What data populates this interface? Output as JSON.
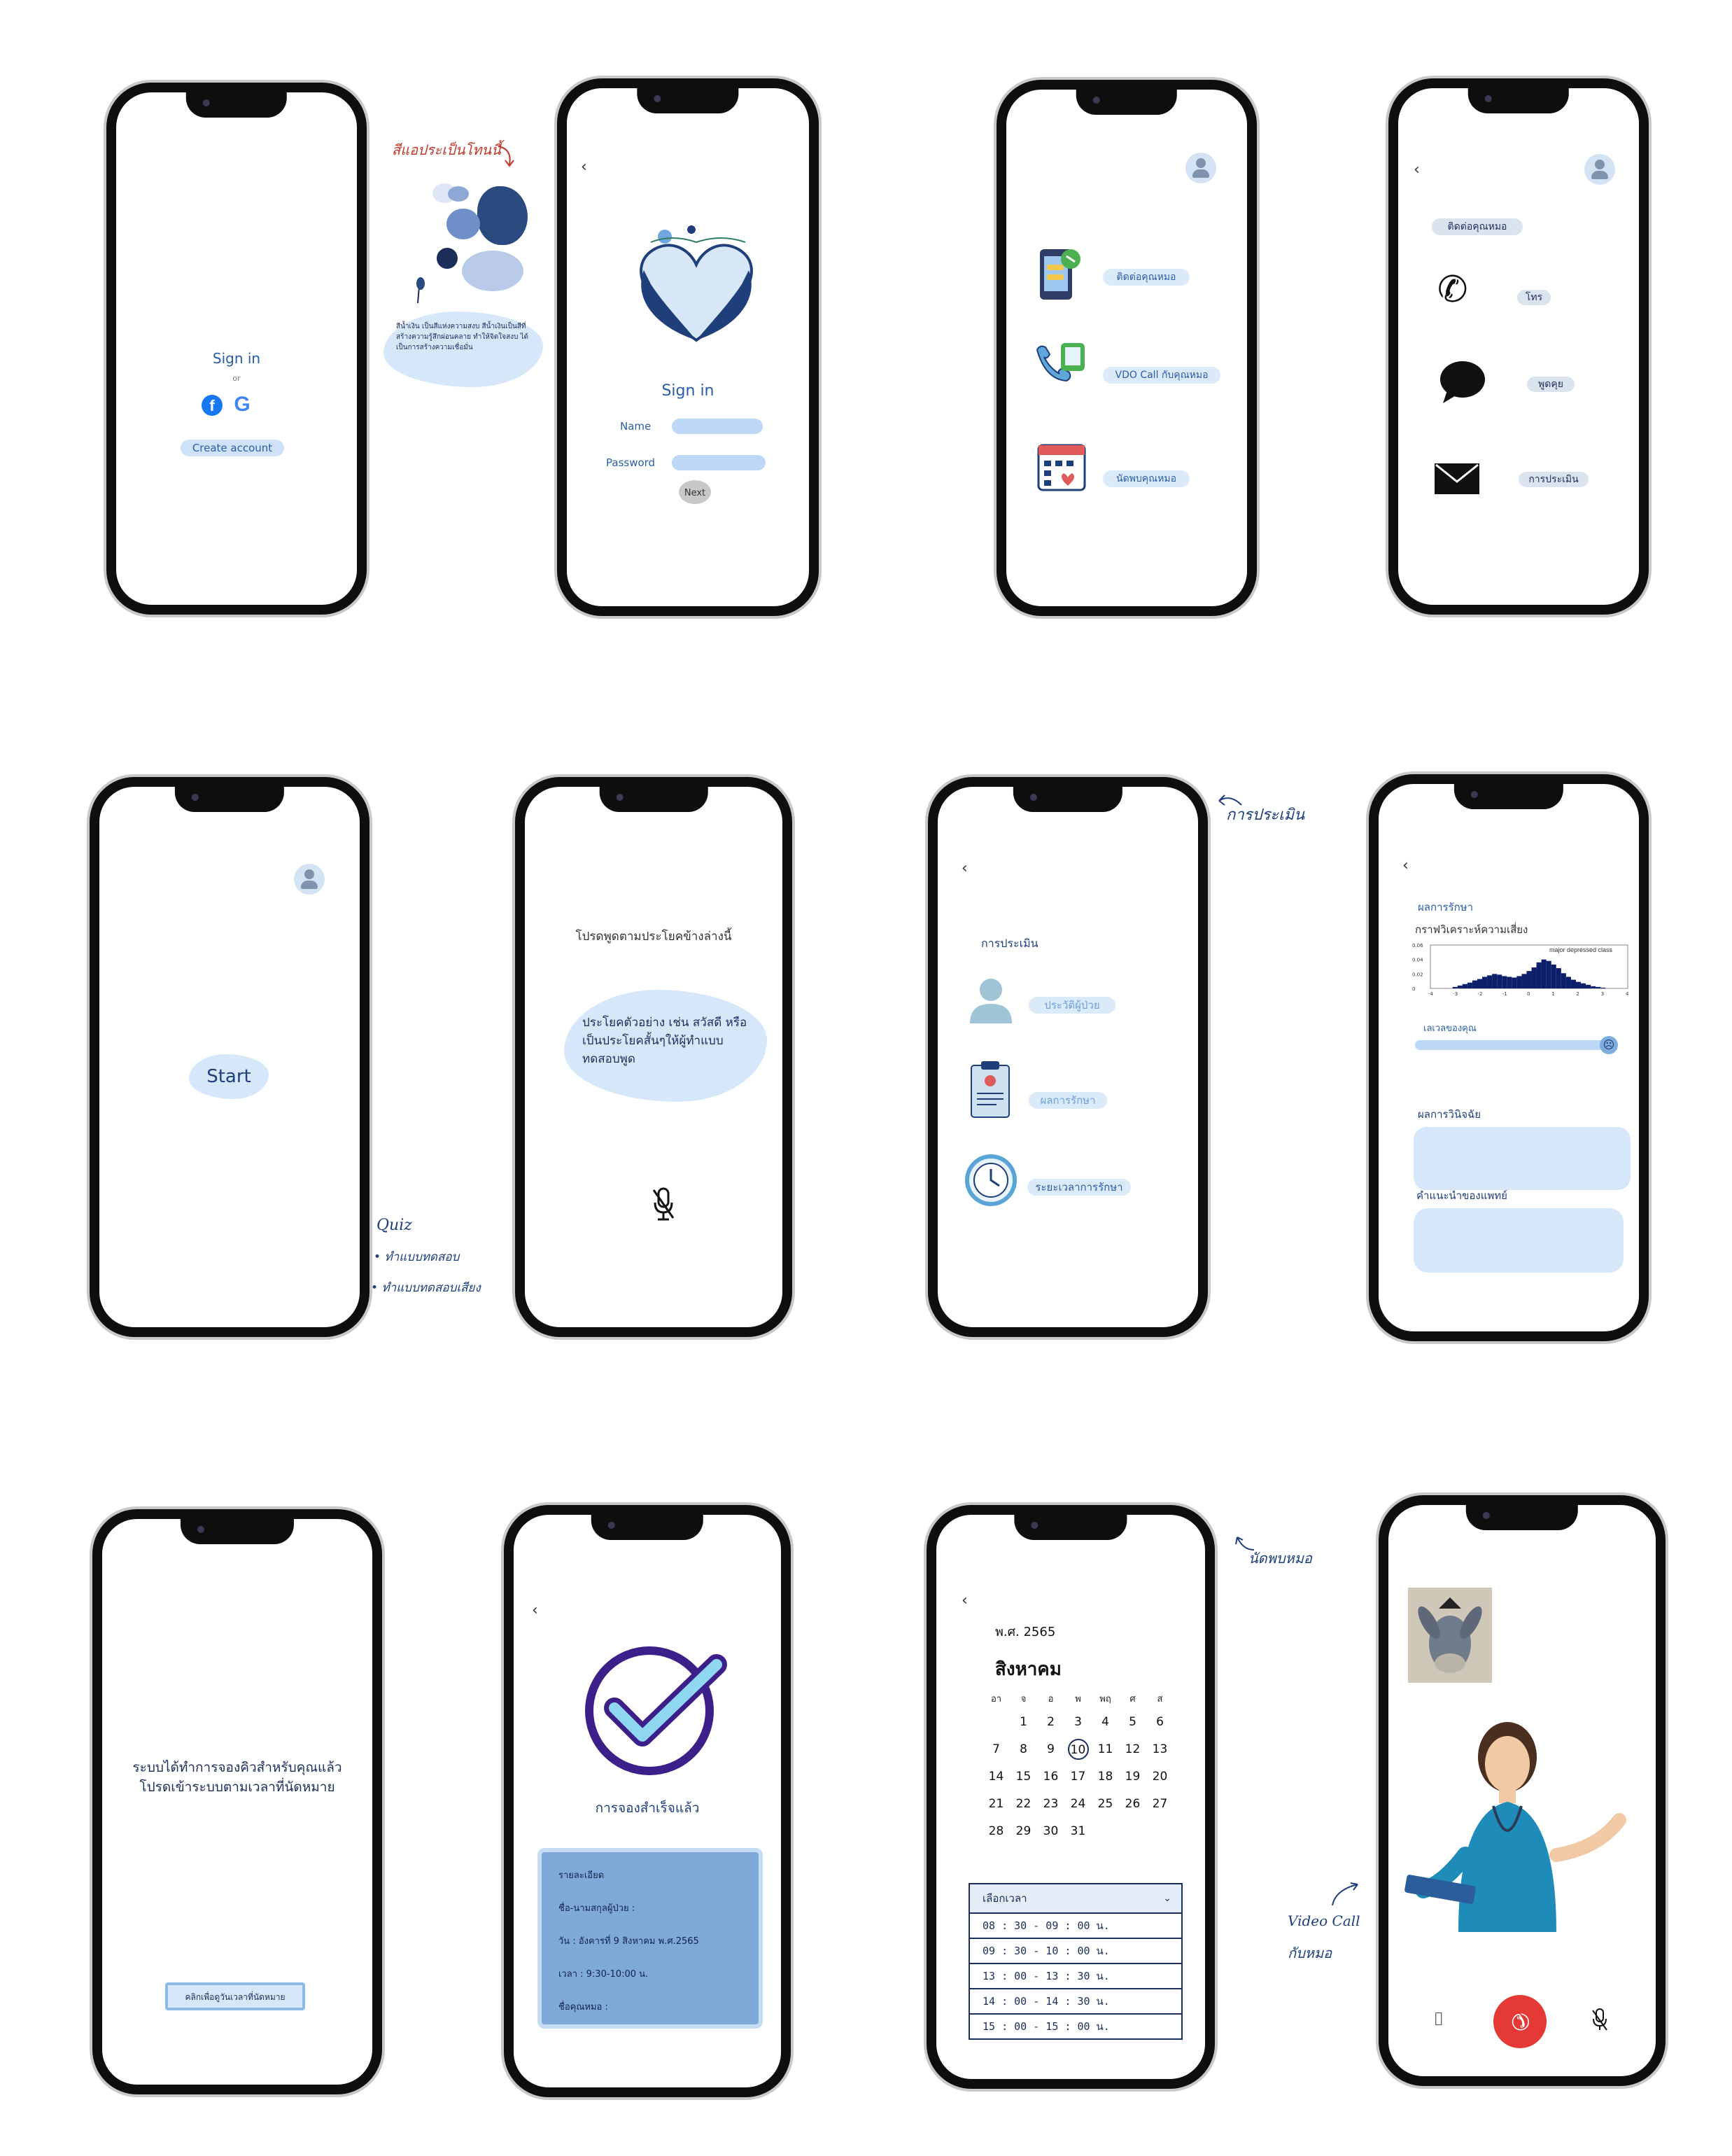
{
  "notes": {
    "color_note": "สีแอประเป็นโทนนี้",
    "color_desc": "สีน้ำเงิน เป็นสีแห่งความสงบ สีน้ำเงินเป็นสีที่สร้างความรู้สึกผ่อนคลาย ทำให้จิตใจสงบ ได้เป็นการสร้างความเชื่อมั่น",
    "assessment": "การประเมิน",
    "quiz_title": "Quiz",
    "quiz_item1": "ทำแบบทดสอบ",
    "quiz_item2": "ทำแบบทดสอบเสียง",
    "appointment": "นัดพบหมอ",
    "video_call_1": "Video Call",
    "video_call_2": "กับหมอ"
  },
  "swatch_labels": [
    "#2B4A80",
    "#6E8FC8",
    "#1B2E5A",
    "#B9CBE8",
    "#DCE6F5",
    "#8FA9D6"
  ],
  "s1": {
    "title": "Sign in",
    "or": "or",
    "create": "Create account"
  },
  "s2": {
    "title": "Sign in",
    "name_label": "Name",
    "password_label": "Password",
    "next": "Next"
  },
  "s3": {
    "items": [
      "ติดต่อคุณหมอ",
      "VDO Call กับคุณหมอ",
      "นัดพบคุณหมอ"
    ]
  },
  "s4": {
    "title": "ติดต่อคุณหมอ",
    "items": [
      "โทร",
      "พูดคุย",
      "การประเมิน"
    ]
  },
  "s5": {
    "start": "Start"
  },
  "s6": {
    "prompt": "โปรดพูดตามประโยคข้างล่างนี้",
    "sentence": "ประโยคตัวอย่าง เช่น สวัสดี หรือเป็นประโยคสั้นๆให้ผู้ทำแบบทดสอบพูด"
  },
  "s7": {
    "title": "การประเมิน",
    "items": [
      "ประวัติผู้ป่วย",
      "ผลการรักษา",
      "ระยะเวลาการรักษา"
    ]
  },
  "s8": {
    "title": "ผลการรักษา",
    "graph_title": "กราฟวิเคราะห์ความเสี่ยง",
    "chart_label": "major depressed class",
    "level_label": "เลเวลของคุณ",
    "diagnosis": "ผลการวินิจฉัย",
    "advice": "คำแนะนำของแพทย์"
  },
  "chart_data": {
    "type": "bar",
    "title": "",
    "annotation": "major depressed class",
    "x_ticks": [
      "-4",
      "-3",
      "-2",
      "-1",
      "0",
      "1",
      "2",
      "3",
      "4"
    ],
    "y_ticks": [
      "0.06",
      "0.04",
      "0.02",
      "0"
    ],
    "xlim": [
      -4,
      4
    ],
    "ylim": [
      0,
      0.06
    ],
    "x": [
      -3.0,
      -2.8,
      -2.6,
      -2.4,
      -2.2,
      -2.0,
      -1.8,
      -1.6,
      -1.4,
      -1.2,
      -1.0,
      -0.8,
      -0.6,
      -0.4,
      -0.2,
      0.0,
      0.2,
      0.4,
      0.6,
      0.8,
      1.0,
      1.2,
      1.4,
      1.6,
      1.8,
      2.0,
      2.2,
      2.4,
      2.6,
      2.8,
      3.0
    ],
    "values": [
      0.002,
      0.004,
      0.006,
      0.008,
      0.011,
      0.013,
      0.016,
      0.018,
      0.02,
      0.019,
      0.017,
      0.016,
      0.015,
      0.017,
      0.02,
      0.024,
      0.029,
      0.036,
      0.04,
      0.038,
      0.033,
      0.028,
      0.021,
      0.016,
      0.012,
      0.009,
      0.007,
      0.005,
      0.003,
      0.002,
      0.001
    ],
    "color": "#0c1f6b"
  },
  "s9": {
    "line1": "ระบบได้ทำการจองคิวสำหรับคุณแล้ว",
    "line2": "โปรดเข้าระบบตามเวลาที่นัดหมาย",
    "button": "คลิกเพื่อดูวันเวลาที่นัดหมาย"
  },
  "s10": {
    "title": "การจองสำเร็จแล้ว",
    "details_title": "รายละเอียด",
    "patient": "ชื่อ-นามสกุลผู้ป่วย :",
    "date": "วัน : อังคารที่ 9 สิงหาคม พ.ศ.2565",
    "time": "เวลา : 9:30-10:00 น.",
    "doctor": "ชื่อคุณหมอ :"
  },
  "s11": {
    "year": "พ.ศ. 2565",
    "month": "สิงหาคม",
    "weekdays": [
      "อา",
      "จ",
      "อ",
      "พ",
      "พฤ",
      "ศ",
      "ส"
    ],
    "weeks": [
      [
        "",
        "1",
        "2",
        "3",
        "4",
        "5",
        "6"
      ],
      [
        "7",
        "8",
        "9",
        "10",
        "11",
        "12",
        "13"
      ],
      [
        "14",
        "15",
        "16",
        "17",
        "18",
        "19",
        "20"
      ],
      [
        "21",
        "22",
        "23",
        "24",
        "25",
        "26",
        "27"
      ],
      [
        "28",
        "29",
        "30",
        "31",
        "",
        "",
        ""
      ]
    ],
    "selected_day": "10",
    "select_time": "เลือกเวลา",
    "slots": [
      "08 : 30  -  09 : 00  น.",
      "09 : 30  -  10 : 00  น.",
      "13 : 00  -  13 : 30  น.",
      "14 : 00  -  14 : 30  น.",
      "15 : 00  -  15 : 00  น."
    ]
  }
}
